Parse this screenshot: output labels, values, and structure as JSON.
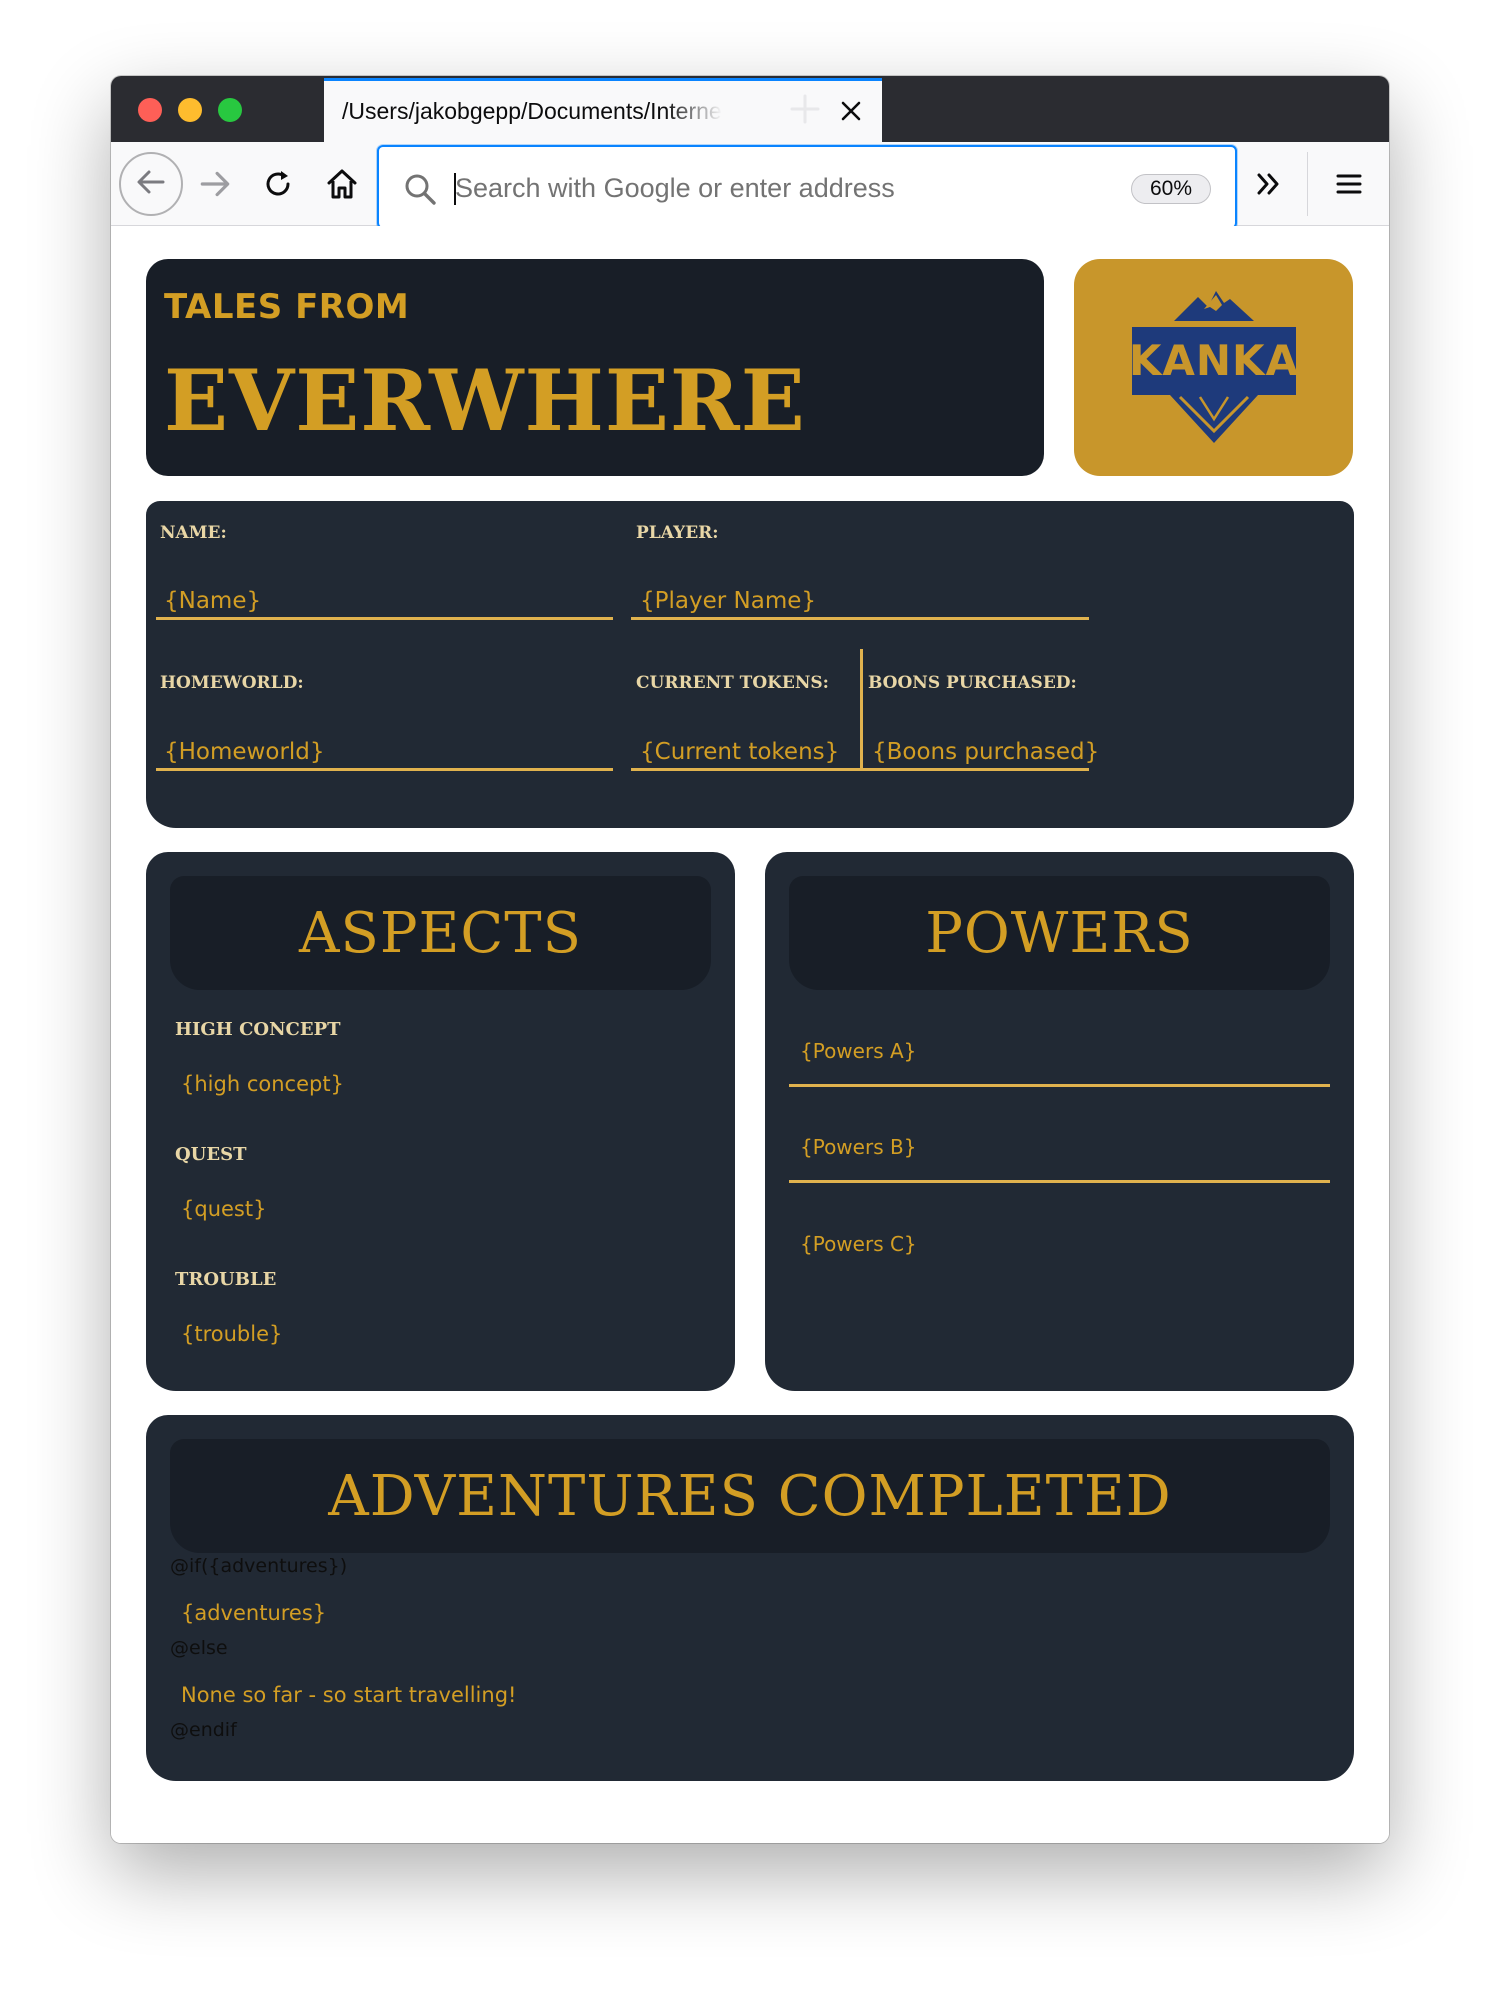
{
  "browser": {
    "tab_title": "/Users/jakobgepp/Documents/Internet",
    "url_placeholder": "Search with Google or enter address",
    "zoom_level": "60%"
  },
  "sheet": {
    "header": {
      "kicker": "TALES FROM",
      "title": "EVERWHERE",
      "logo_text": "KANKA"
    },
    "fields": {
      "name_label": "NAME:",
      "name_value": "{Name}",
      "player_label": "PLAYER:",
      "player_value": "{Player Name}",
      "homeworld_label": "HOMEWORLD:",
      "homeworld_value": "{Homeworld}",
      "tokens_label": "CURRENT TOKENS:",
      "tokens_value": "{Current tokens}",
      "boons_label": "BOONS PURCHASED:",
      "boons_value": "{Boons purchased}"
    },
    "aspects": {
      "title": "ASPECTS",
      "items": [
        {
          "label": "HIGH CONCEPT",
          "value": "{high concept}"
        },
        {
          "label": "QUEST",
          "value": "{quest}"
        },
        {
          "label": "TROUBLE",
          "value": "{trouble}"
        }
      ]
    },
    "powers": {
      "title": "POWERS",
      "items": [
        "{Powers A}",
        "{Powers B}",
        "{Powers C}"
      ]
    },
    "adventures": {
      "title": "ADVENTURES COMPLETED",
      "if_directive": "@if({adventures})",
      "value": "{adventures}",
      "else_directive": "@else",
      "fallback": "None so far - so start travelling!",
      "endif_directive": "@endif"
    }
  },
  "colors": {
    "gold": "#d39e24",
    "panel": "#212934",
    "panel_dark": "#181e27",
    "logo_bg": "#c8962b",
    "logo_blue": "#1e3a7b",
    "focus_blue": "#0a84ff"
  },
  "icons": [
    "back-arrow-icon",
    "forward-arrow-icon",
    "reload-icon",
    "home-icon",
    "search-icon",
    "overflow-chevrons-icon",
    "hamburger-menu-icon",
    "close-icon",
    "plus-icon",
    "kanka-logo-icon"
  ]
}
